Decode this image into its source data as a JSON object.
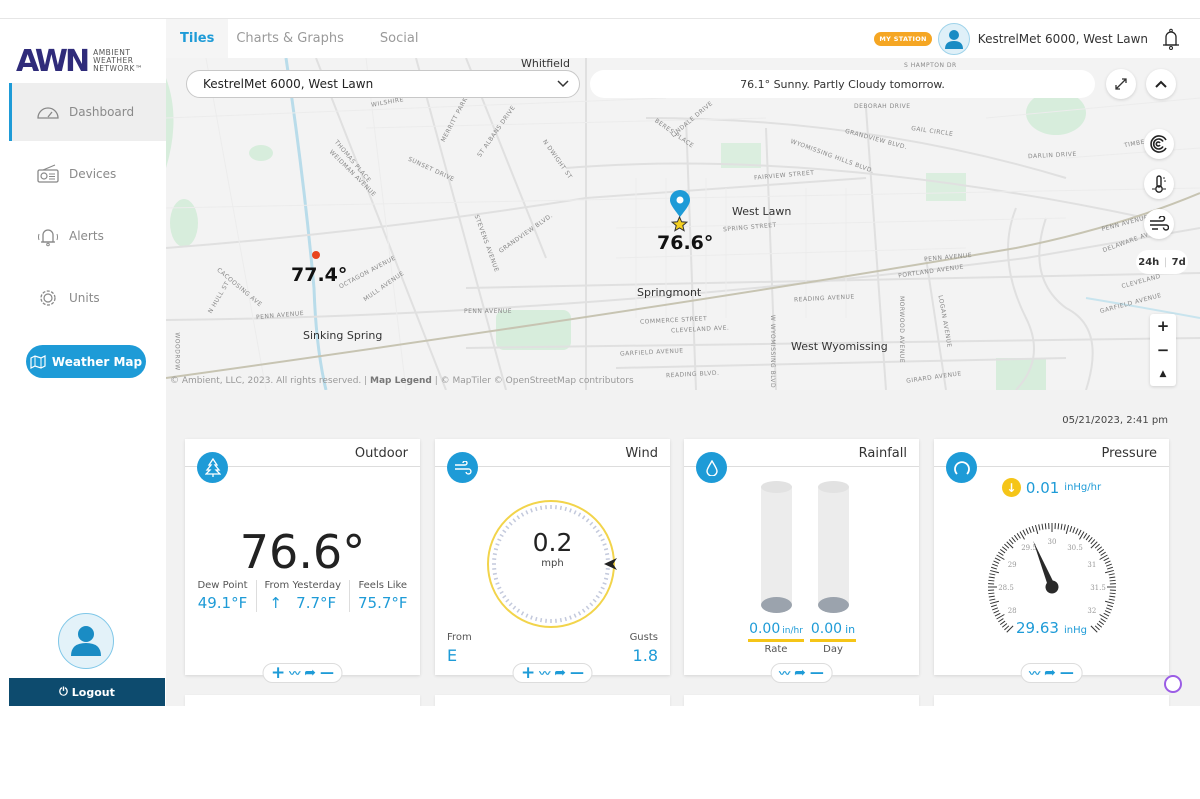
{
  "app": {
    "logo_mark": "AWN",
    "logo_text": [
      "AMBIENT",
      "WEATHER",
      "NETWORK™"
    ]
  },
  "sidebar": {
    "items": [
      {
        "label": "Dashboard",
        "icon": "gauge-icon",
        "active": true
      },
      {
        "label": "Devices",
        "icon": "radio-device-icon",
        "active": false
      },
      {
        "label": "Alerts",
        "icon": "bell-ringing-icon",
        "active": false
      },
      {
        "label": "Units",
        "icon": "gear-icon",
        "active": false
      }
    ],
    "weather_map_label": "Weather Map",
    "logout_label": "Logout"
  },
  "header": {
    "tabs": [
      {
        "label": "Tiles",
        "active": true
      },
      {
        "label": "Charts & Graphs",
        "active": false
      },
      {
        "label": "Social",
        "active": false
      }
    ],
    "badge": "MY STATION",
    "station_name": "KestrelMet 6000, West Lawn"
  },
  "map": {
    "station_select": "KestrelMet 6000, West Lawn",
    "forecast": "76.1° Sunny. Partly Cloudy tomorrow.",
    "range_options": [
      "24h",
      "7d"
    ],
    "zoom_in": "+",
    "zoom_out": "−",
    "north": "▲",
    "attribution_prefix": "© Ambient, LLC, 2023. All rights reserved. | ",
    "attribution_legend": "Map Legend",
    "attribution_suffix": " | © MapTiler © OpenStreetMap contributors",
    "places": {
      "whitfield": "Whitfield",
      "west_lawn": "West Lawn",
      "springmont": "Springmont",
      "sinking_spring": "Sinking Spring",
      "west_wyomissing": "West Wyomissing"
    },
    "streets": {
      "s1": "WILSHIRE",
      "s2": "MERRITT PARKWAY",
      "s3": "ST ALBANS DRIVE",
      "s4": "THOMAS PLACE",
      "s5": "WEIDMAN AVENUE",
      "s6": "SUNSET DRIVE",
      "s7": "N DWIGHT ST",
      "s8": "GRANDVIEW BLVD.",
      "s9": "STEVENS AVENUE",
      "s10": "OCTAGON AVENUE",
      "s11": "MULL AVENUE",
      "s12": "CACOOSING AVE",
      "s13": "N HULL ST",
      "s14": "PENN AVENUE",
      "s15": "PENN AVENUE",
      "s16": "BERES PLACE",
      "s17": "LINDALE DRIVE",
      "s18": "DEBORAH DRIVE",
      "s19": "GAIL CIRCLE",
      "s20": "GRANDVIEW BLVD.",
      "s21": "WYOMISSING HILLS BLVD.",
      "s22": "FAIRVIEW STREET",
      "s23": "SPRING STREET",
      "s24": "DARLIN DRIVE",
      "s25": "S HAMPTON DR",
      "s26": "PENN AVENUE",
      "s27": "PORTLAND AVENUE",
      "s28": "READING AVENUE",
      "s29": "COMMERCE STREET",
      "s30": "CLEVELAND AVE.",
      "s31": "GARFIELD AVENUE",
      "s32": "READING BLVD.",
      "s33": "GIRARD AVENUE",
      "s34": "DELAWARE AVENUE",
      "s35": "CLEVELAND",
      "s36": "GARFIELD AVENUE",
      "s37": "TIMBER",
      "s38": "WOODROW",
      "s39": "MORWOOD AVENUE",
      "s40": "LOGAN AVENUE",
      "s41": "W WYOMISSING BLVD",
      "s42": "PENN AVENUE"
    },
    "markers": [
      {
        "temp": "77.4°",
        "color": "#e8451e"
      },
      {
        "temp": "76.6°",
        "color": "#1e9bd7",
        "is_my_station": true
      }
    ]
  },
  "timestamp": "05/21/2023, 2:41 pm",
  "tiles": {
    "outdoor": {
      "title": "Outdoor",
      "temp": "76.6°",
      "stats": [
        {
          "label": "Dew Point",
          "value": "49.1°F"
        },
        {
          "label": "From Yesterday",
          "value": "↑   7.7°F"
        },
        {
          "label": "Feels Like",
          "value": "75.7°F"
        }
      ]
    },
    "wind": {
      "title": "Wind",
      "speed": "0.2",
      "unit": "mph",
      "from_label": "From",
      "from_value": "E",
      "gusts_label": "Gusts",
      "gusts_value": "1.8",
      "direction_deg": 90
    },
    "rainfall": {
      "title": "Rainfall",
      "rate_value": "0.00",
      "rate_unit": "in/hr",
      "rate_label": "Rate",
      "day_value": "0.00",
      "day_unit": "in",
      "day_label": "Day"
    },
    "pressure": {
      "title": "Pressure",
      "trend_value": "0.01",
      "trend_unit": "inHg/hr",
      "trend_direction": "down",
      "value": "29.63",
      "unit": "inHg",
      "gauge_min": 27.75,
      "gauge_max": 32.25,
      "gauge_labels": [
        "28",
        "28.5",
        "29",
        "29.5",
        "30",
        "30.5",
        "31",
        "31.5",
        "32"
      ],
      "reading": 29.63
    }
  },
  "tile_tools": {
    "add": "+",
    "chart": "〰",
    "share": "➦",
    "remove": "—"
  },
  "colors": {
    "accent": "#1e9bd7",
    "logout_bg": "#0d4b6e",
    "badge": "#f5a623",
    "wind_ring": "#f2d44b",
    "rain_underline": "#f5c518"
  }
}
